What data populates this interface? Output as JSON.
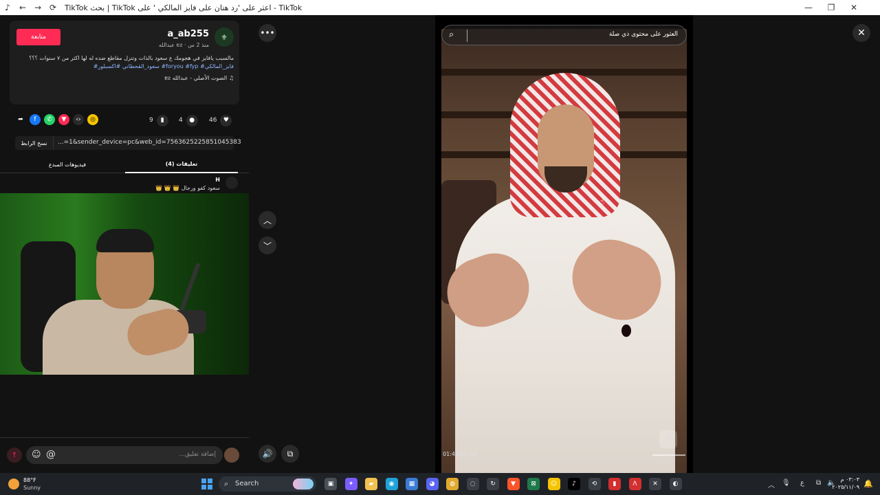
{
  "window": {
    "title": "TikTok بحث | TikTok اعثر على 'رد هتان على فايز المالكي ' على - TikTok",
    "app_icon": "tiktok-icon",
    "back_icon": "←",
    "forward_icon": "→",
    "refresh_icon": "⟳",
    "min": "—",
    "max": "❐",
    "close": "✕"
  },
  "post": {
    "username": "a_ab255",
    "meta": "عبدالله ɐƨ · منذ 2 س",
    "follow_label": "متابعة",
    "avatar_glyph": "⚜",
    "description": "مالسبب يافايز في هجومك ع سعود بالذات وتنزل مقاطع ضده له لها اكثر من ٧ سنوات ؟؟؟",
    "hashtags": "#سعود_القحطاني #اكسبلور #foryou #fyp #فايز_المالكي",
    "music": "♫ الصوت الأصلي - عبدالله ɐƨ"
  },
  "stats": {
    "likes": "46",
    "comments": "4",
    "saves": "9"
  },
  "share_icons": [
    {
      "name": "coin-icon",
      "glyph": "◎",
      "color": "#f4c400"
    },
    {
      "name": "embed-icon",
      "glyph": "‹›",
      "color": "#2a2a2a"
    },
    {
      "name": "send-icon",
      "glyph": "▼",
      "color": "#fe2c55"
    },
    {
      "name": "whatsapp-icon",
      "glyph": "✆",
      "color": "#25d366"
    },
    {
      "name": "facebook-icon",
      "glyph": "f",
      "color": "#1877f2"
    },
    {
      "name": "share-arrow-icon",
      "glyph": "➦",
      "color": "transparent"
    }
  ],
  "link": {
    "copy_label": "نسخ الرابط",
    "url": "...=1&sender_device=pc&web_id=7563625225851045383"
  },
  "tabs": {
    "comments": "(4) تعليقات",
    "creator_videos": "فيديوهات المبدع"
  },
  "comments": [
    {
      "author": "H",
      "text": "سعود كفو ورجال 👑 👑 👑"
    }
  ],
  "comment_input": {
    "placeholder": "إضافة تعليق...",
    "emoji_glyph": "☺",
    "at_glyph": "@",
    "send_glyph": "↑"
  },
  "controls": {
    "more": "•••",
    "up": "︿",
    "down": "﹀",
    "volume": "🔊",
    "pip": "⧉",
    "close": "✕"
  },
  "video": {
    "search_placeholder": "العثور على محتوى ذي صلة",
    "search_glyph": "⌕",
    "timecode": "01:49/00:18",
    "captions_glyph": "☰",
    "progress": 0.14
  },
  "taskbar": {
    "temp": "88°F",
    "weather": "Sunny",
    "search_label": "Search",
    "apps": [
      {
        "name": "task-view-icon",
        "glyph": "▣",
        "color": "#4a4f57"
      },
      {
        "name": "copilot-icon",
        "glyph": "✦",
        "color": "#7a5cff"
      },
      {
        "name": "file-explorer-icon",
        "glyph": "▰",
        "color": "#f2c14e"
      },
      {
        "name": "edge-icon",
        "glyph": "◉",
        "color": "#1fa3d8"
      },
      {
        "name": "store-icon",
        "glyph": "▦",
        "color": "#3a7bd5"
      },
      {
        "name": "discord-icon",
        "glyph": "◕",
        "color": "#5865f2"
      },
      {
        "name": "chrome-icon",
        "glyph": "◍",
        "color": "#e0a82e"
      },
      {
        "name": "app-icon-1",
        "glyph": "◌",
        "color": "#3b3f45"
      },
      {
        "name": "app-icon-2",
        "glyph": "↻",
        "color": "#3b3f45"
      },
      {
        "name": "brave-icon",
        "glyph": "▼",
        "color": "#fb542b"
      },
      {
        "name": "app-icon-3",
        "glyph": "⊠",
        "color": "#1e7a4a"
      },
      {
        "name": "app-icon-4",
        "glyph": "☺",
        "color": "#f4c400"
      },
      {
        "name": "tiktok-icon",
        "glyph": "♪",
        "color": "#000000"
      },
      {
        "name": "app-icon-5",
        "glyph": "⟲",
        "color": "#3b3f45"
      },
      {
        "name": "app-icon-6",
        "glyph": "▮",
        "color": "#d32f2f"
      },
      {
        "name": "app-icon-7",
        "glyph": "Λ",
        "color": "#d32f2f"
      },
      {
        "name": "app-icon-8",
        "glyph": "✕",
        "color": "#3b3f45"
      },
      {
        "name": "app-icon-9",
        "glyph": "◐",
        "color": "#3b3f45"
      }
    ],
    "tray": [
      "︿",
      "🎙",
      "ع",
      "⧉",
      "🔈"
    ],
    "time": "٠٣:٠٣ م",
    "date": "٢٠٢٥/١١/٠٩",
    "notif_glyph": "🔔"
  }
}
